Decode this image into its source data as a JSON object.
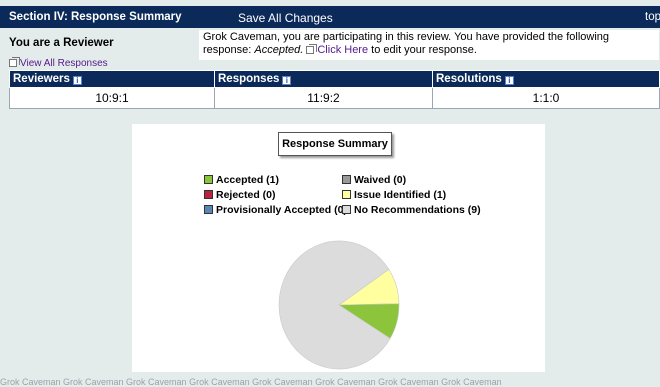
{
  "header": {
    "title": "Section IV: Response Summary",
    "save_label": "Save All Changes",
    "top_label": "top"
  },
  "reviewer": {
    "role": "You are a Reviewer",
    "message_pre": "Grok Caveman, you are participating in this review. You have provided the following response:",
    "response": "Accepted.",
    "link_label": "Click Here",
    "message_post": "to edit your response."
  },
  "view_all_label": "View All Responses",
  "counts": {
    "headers": [
      "Reviewers",
      "Responses",
      "Resolutions"
    ],
    "values": [
      "10:9:1",
      "11:9:2",
      "1:1:0"
    ]
  },
  "chart_data": {
    "type": "pie",
    "title": "Response Summary",
    "legend": [
      {
        "label": "Accepted (1)",
        "value": 1,
        "color": "#8cc43c"
      },
      {
        "label": "Waived (0)",
        "value": 0,
        "color": "#999999"
      },
      {
        "label": "Rejected (0)",
        "value": 0,
        "color": "#b8243f"
      },
      {
        "label": "Issue Identified (1)",
        "value": 1,
        "color": "#ffffa0"
      },
      {
        "label": "Provisionally Accepted (0)",
        "value": 0,
        "color": "#5b86b4"
      },
      {
        "label": "No Recommendations (9)",
        "value": 9,
        "color": "#dcdcdc"
      }
    ]
  },
  "bottom_text": "Grok Caveman  Grok Caveman  Grok Caveman  Grok Caveman  Grok Caveman  Grok Caveman  Grok Caveman  Grok Caveman"
}
